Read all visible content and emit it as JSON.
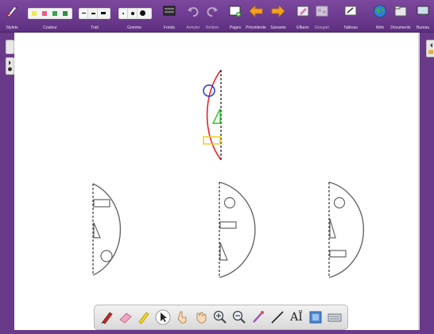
{
  "toolbar": {
    "stylets": "Stylets",
    "couleur": "Couleur",
    "trait": "Trait",
    "gomme": "Gomme",
    "fonds": "Fonds",
    "annuler": "Annuler",
    "refaire": "Refaire",
    "pages": "Pages",
    "precedente": "Précédente",
    "suivante": "Suivante",
    "effacer": "Effacer",
    "grouper": "Grouper",
    "tableau": "Tableau",
    "web": "Web",
    "documents": "Documents",
    "bureau": "Bureau"
  },
  "colors": {
    "toolbar": "#6a3a8a",
    "swatch_yellow": "#f4e84a",
    "swatch_pink": "#ea5d87",
    "swatch_green1": "#3aa34a",
    "swatch_green2": "#2f8f3c",
    "face_red": "#e8232a",
    "circle_blue": "#1d3ad6",
    "triangle_green": "#31c631",
    "rect_yellow": "#e6d02c",
    "outline_gray": "#666666"
  },
  "dock_tools": [
    "red-pen-icon",
    "eraser-icon",
    "highlighter-icon",
    "arrow-pointer-icon",
    "hand-pointer-icon",
    "hand-grab-icon",
    "zoom-in-icon",
    "zoom-out-icon",
    "laser-icon",
    "line-icon",
    "text-icon",
    "screen-capture-icon",
    "keyboard-icon"
  ],
  "dock_text_label": "AÏ"
}
